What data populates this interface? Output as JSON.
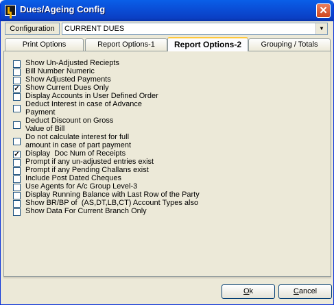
{
  "window": {
    "title": "Dues/Ageing Config",
    "close_glyph": "✕"
  },
  "config": {
    "label": "Configuration",
    "value": "CURRENT DUES",
    "dropdown_glyph": "▼"
  },
  "tabs": [
    {
      "label": "Print Options"
    },
    {
      "label": "Report Options-1"
    },
    {
      "label": "Report Options-2"
    },
    {
      "label": "Grouping / Totals"
    }
  ],
  "active_tab": "Report Options-2",
  "options": [
    {
      "label": "Show Un-Adjusted Reciepts",
      "checked": false
    },
    {
      "label": "Bill Number Numeric",
      "checked": false
    },
    {
      "label": "Show Adjusted Payments",
      "checked": false
    },
    {
      "label": "Show Current Dues Only",
      "checked": true
    },
    {
      "label": "Display Accounts in User Defined Order",
      "checked": false
    },
    {
      "label": "Deduct Interest in case of Advance\nPayment",
      "checked": false
    },
    {
      "label": "Deduct Discount on Gross\nValue of Bill",
      "checked": false
    },
    {
      "label": "Do not calculate interest for full\namount in case of part payment",
      "checked": false
    },
    {
      "label": "Display  Doc Num of Receipts",
      "checked": true
    },
    {
      "label": "Prompt if any un-adjusted entries exist",
      "checked": false
    },
    {
      "label": "Prompt if any Pending Challans exist",
      "checked": false
    },
    {
      "label": "Include Post Dated Cheques",
      "checked": false
    },
    {
      "label": "Use Agents for A/c Group Level-3",
      "checked": false
    },
    {
      "label": "Display Running Balance with Last Row of the Party",
      "checked": false
    },
    {
      "label": "Show BR/BP of  (AS,DT,LB,CT) Account Types also",
      "checked": false
    },
    {
      "label": "Show Data For Current Branch Only",
      "checked": false
    }
  ],
  "buttons": {
    "ok": {
      "mnemonic": "O",
      "rest": "k"
    },
    "cancel": {
      "mnemonic": "C",
      "rest": "ancel"
    }
  },
  "colors": {
    "title_bar": "#0a4fd8",
    "active_tab_accent": "#ffc83c",
    "window_face": "#ece9d8"
  }
}
